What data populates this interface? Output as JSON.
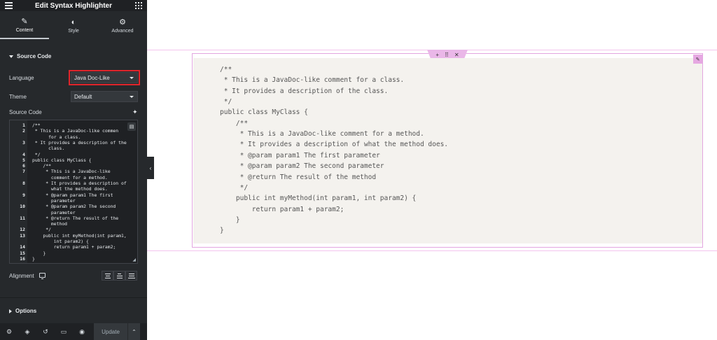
{
  "header": {
    "title": "Edit Syntax Highlighter"
  },
  "tabs": [
    {
      "label": "Content",
      "icon": "pencil-icon"
    },
    {
      "label": "Style",
      "icon": "half-circle-icon"
    },
    {
      "label": "Advanced",
      "icon": "gear-icon"
    }
  ],
  "section": {
    "source_code_title": "Source Code",
    "options_title": "Options"
  },
  "controls": {
    "language_label": "Language",
    "language_value": "Java Doc-Like",
    "theme_label": "Theme",
    "theme_value": "Default",
    "source_code_label": "Source Code",
    "alignment_label": "Alignment"
  },
  "editor": {
    "lines": [
      {
        "num": "1",
        "text": "/**"
      },
      {
        "num": "2",
        "text": " * This is a JavaDoc-like commen"
      },
      {
        "num": "",
        "text": "      for a class."
      },
      {
        "num": "3",
        "text": " * It provides a description of the"
      },
      {
        "num": "",
        "text": "      class."
      },
      {
        "num": "4",
        "text": " */"
      },
      {
        "num": "5",
        "text": "public class MyClass {"
      },
      {
        "num": "6",
        "text": "    /**"
      },
      {
        "num": "7",
        "text": "     * This is a JavaDoc-like"
      },
      {
        "num": "",
        "text": "       comment for a method."
      },
      {
        "num": "8",
        "text": "     * It provides a description of"
      },
      {
        "num": "",
        "text": "       what the method does."
      },
      {
        "num": "9",
        "text": "     * @param param1 The first"
      },
      {
        "num": "",
        "text": "       parameter"
      },
      {
        "num": "10",
        "text": "     * @param param2 The second"
      },
      {
        "num": "",
        "text": "       parameter"
      },
      {
        "num": "11",
        "text": "     * @return The result of the"
      },
      {
        "num": "",
        "text": "       method"
      },
      {
        "num": "12",
        "text": "     */"
      },
      {
        "num": "13",
        "text": "    public int myMethod(int param1,"
      },
      {
        "num": "",
        "text": "        int param2) {"
      },
      {
        "num": "14",
        "text": "        return param1 + param2;"
      },
      {
        "num": "15",
        "text": "    }"
      },
      {
        "num": "16",
        "text": "}"
      }
    ]
  },
  "footer": {
    "update_label": "Update"
  },
  "preview": {
    "handle_icons": [
      "plus-icon",
      "drag-icon",
      "close-icon"
    ],
    "lines": [
      "/**",
      " * This is a JavaDoc-like comment for a class.",
      " * It provides a description of the class.",
      " */",
      "public class MyClass {",
      "    /**",
      "     * This is a JavaDoc-like comment for a method.",
      "     * It provides a description of what the method does.",
      "     * @param param1 The first parameter",
      "     * @param param2 The second parameter",
      "     * @return The result of the method",
      "     */",
      "    public int myMethod(int param1, int param2) {",
      "        return param1 + param2;",
      "    }",
      "}"
    ]
  },
  "colors": {
    "panel_bg": "#26292c",
    "highlight": "#e0252b",
    "widget_border": "#e3a6e0",
    "code_bg": "#f4f2ee"
  }
}
